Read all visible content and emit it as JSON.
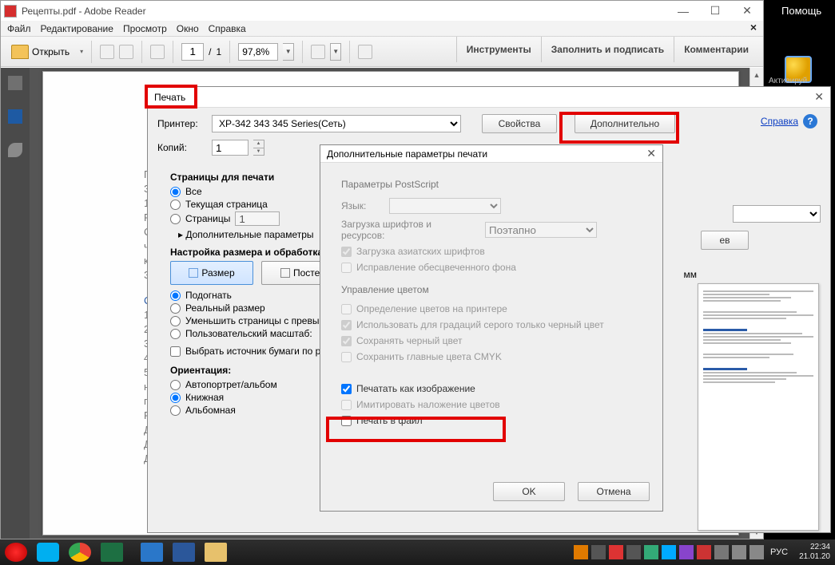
{
  "window": {
    "title": "Рецепты.pdf - Adobe Reader",
    "minimize": "—",
    "maximize": "☐",
    "close": "✕"
  },
  "menubar": {
    "file": "Файл",
    "edit": "Редактирование",
    "view": "Просмотр",
    "window": "Окно",
    "help": "Справка"
  },
  "toolbar": {
    "open": "Открыть",
    "open_dd": "▾",
    "page_current": "1",
    "page_sep": "/",
    "page_total": "1",
    "zoom_pct": "97,8%",
    "tools": "Инструменты",
    "fillsign": "Заполнить и подписать",
    "comments": "Комментарии"
  },
  "docstrips": {
    "l0": "П",
    "l1": "З",
    "l2": "1",
    "l3": "Р",
    "l4": "С",
    "l5": "ч",
    "l6": "к",
    "l7": "З",
    "l8": "С",
    "l9": "1",
    "l10": "2",
    "l11": "3",
    "l12": "4",
    "l13": "5",
    "l14": "н",
    "l15": "п",
    "l16": "Р",
    "l17": "Д",
    "l18": "Д",
    "l19": "Д"
  },
  "print": {
    "title": "Печать",
    "help_link": "Справка",
    "help_icon": "?",
    "printer_label": "Принтер:",
    "printer_selected": "XP-342 343 345 Series(Сеть)",
    "properties_btn": "Свойства",
    "advanced_btn": "Дополнительно",
    "copies_label": "Копий:",
    "copies_value": "1",
    "pages_title": "Страницы для печати",
    "opt_all": "Все",
    "opt_current": "Текущая страница",
    "opt_pages": "Страницы",
    "opt_pages_val": "1",
    "more_params": "▸  Дополнительные параметры",
    "sizing_title": "Настройка размера и обработка",
    "seg_size": "Размер",
    "seg_poster": "Постер",
    "fit": "Подогнать",
    "real": "Реальный размер",
    "shrink": "Уменьшить страницы с превы",
    "custom_scale": "Пользовательский масштаб:",
    "paper_source_cb": "Выбрать источник бумаги по p",
    "orientation_title": "Ориентация:",
    "orient_auto": "Автопортрет/альбом",
    "orient_portrait": "Книжная",
    "orient_landscape": "Альбомная",
    "preview_mm": "мм",
    "preview_sel_btn": "ев"
  },
  "adv": {
    "title": "Дополнительные параметры печати",
    "ps_section": "Параметры PostScript",
    "ps_lang": "Язык:",
    "ps_fonts": "Загрузка шрифтов и ресурсов:",
    "ps_fonts_val": "Поэтапно",
    "asian_fonts": "Загрузка азиатских шрифтов",
    "fix_bg": "Исправление обесцвеченного фона",
    "color_section": "Управление цветом",
    "c1": "Определение цветов на принтере",
    "c2": "Использовать для градаций серого только черный цвет",
    "c3": "Сохранять черный цвет",
    "c4": "Сохранить главные цвета CMYK",
    "print_as_image": "Печатать как изображение",
    "overprint": "Имитировать наложение цветов",
    "to_file": "Печать в файл",
    "ok": "OK",
    "cancel": "Отмена"
  },
  "right": {
    "help": "Помощь",
    "activate": "Активируй"
  },
  "taskbar": {
    "lang": "РУС",
    "time": "22:34",
    "date": "21.01.20"
  }
}
